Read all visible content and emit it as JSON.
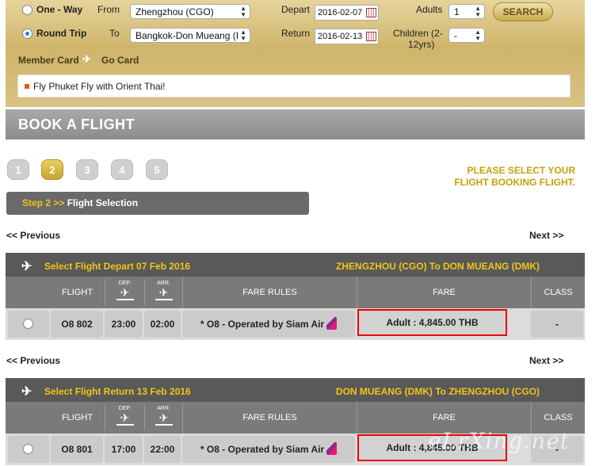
{
  "search_form": {
    "trip_type": {
      "one_way_label": "One - Way",
      "round_trip_label": "Round Trip",
      "selected": "round_trip"
    },
    "from_label": "From",
    "from_value": "Zhengzhou (CGO)",
    "to_label": "To",
    "to_value": "Bangkok-Don Mueang (I",
    "depart_label": "Depart",
    "depart_value": "2016-02-07",
    "return_label": "Return",
    "return_value": "2016-02-13",
    "adults_label": "Adults",
    "adults_value": "1",
    "children_label": "Children (2-",
    "children_label_2": "12yrs)",
    "children_value": "-",
    "search_button": "SEARCH",
    "member_card_label": "Member Card",
    "go_card_label": "Go Card",
    "promo_text": "Fly Phuket Fly with Orient Thai!"
  },
  "book_flight": {
    "title": "BOOK A FLIGHT",
    "steps": [
      "1",
      "2",
      "3",
      "4",
      "5"
    ],
    "active_step": 2,
    "instruction_line1": "PLEASE SELECT YOUR",
    "instruction_line2": "FLIGHT BOOKING FLIGHT.",
    "step_prefix": "Step 2 >>",
    "step_title": "Flight Selection",
    "previous_link": "<< Previous",
    "next_link": "Next >>"
  },
  "columns": {
    "flight": "FLIGHT",
    "dep": "DEP.",
    "arr": "ARR.",
    "fare_rules": "FARE RULES",
    "fare": "FARE",
    "class": "CLASS"
  },
  "depart_section": {
    "title": "Select Flight Depart 07 Feb 2016",
    "route": "ZHENGZHOU (CGO) To DON MUEANG (DMK)",
    "flight": {
      "number": "O8 802",
      "dep": "23:00",
      "arr": "02:00",
      "fare_rules": "* O8 - Operated by Siam Air",
      "fare": "Adult : 4,845.00 THB",
      "class": "-"
    }
  },
  "return_section": {
    "title": "Select Flight Return 13 Feb 2016",
    "route": "DON MUEANG (DMK) To ZHENGZHOU (CGO)",
    "flight": {
      "number": "O8 801",
      "dep": "17:00",
      "arr": "22:00",
      "fare_rules": "* O8 - Operated by Siam Air",
      "fare": "Adult : 4,845.00 THB",
      "class": "-"
    }
  },
  "watermark": "eLrXing.net",
  "colors": {
    "gold": "#c9a00a",
    "header_gray": "#595959",
    "highlight_red": "#e00000"
  }
}
